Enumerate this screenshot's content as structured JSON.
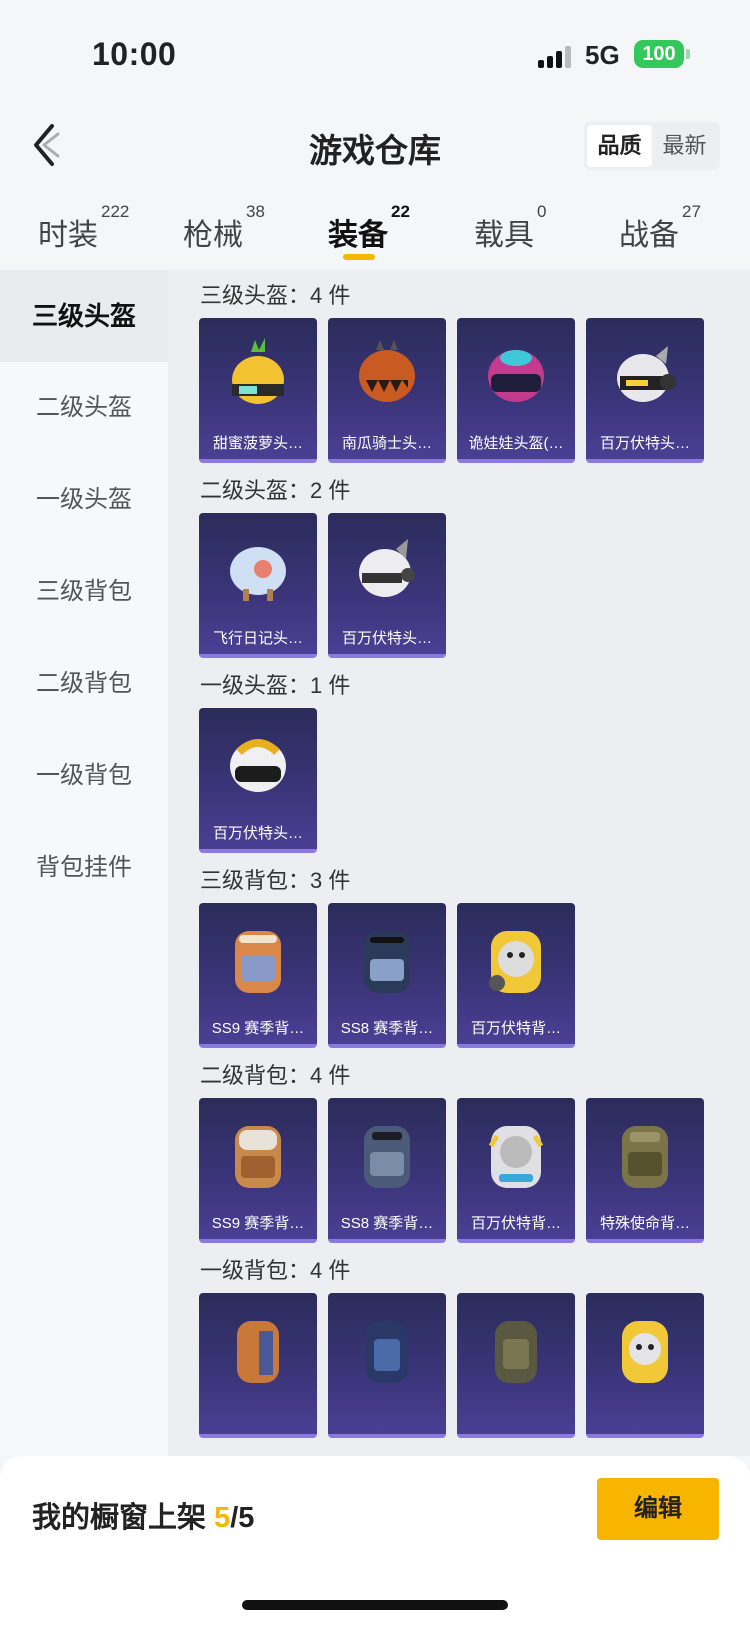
{
  "status": {
    "time": "10:00",
    "network": "5G",
    "battery": "100"
  },
  "header": {
    "title": "游戏仓库",
    "sort_quality": "品质",
    "sort_latest": "最新"
  },
  "tabs": [
    {
      "label": "时装",
      "count": "222"
    },
    {
      "label": "枪械",
      "count": "38"
    },
    {
      "label": "装备",
      "count": "22"
    },
    {
      "label": "载具",
      "count": "0"
    },
    {
      "label": "战备",
      "count": "27"
    }
  ],
  "sidebar": {
    "items": [
      "三级头盔",
      "二级头盔",
      "一级头盔",
      "三级背包",
      "二级背包",
      "一级背包",
      "背包挂件"
    ]
  },
  "sections": [
    {
      "title": "三级头盔：4 件",
      "items": [
        "甜蜜菠萝头…",
        "南瓜骑士头…",
        "诡娃娃头盔(…",
        "百万伏特头…"
      ]
    },
    {
      "title": "二级头盔：2 件",
      "items": [
        "飞行日记头…",
        "百万伏特头…"
      ]
    },
    {
      "title": "一级头盔：1 件",
      "items": [
        "百万伏特头…"
      ]
    },
    {
      "title": "三级背包：3 件",
      "items": [
        "SS9 赛季背…",
        "SS8 赛季背…",
        "百万伏特背…"
      ]
    },
    {
      "title": "二级背包：4 件",
      "items": [
        "SS9 赛季背…",
        "SS8 赛季背…",
        "百万伏特背…",
        "特殊使命背…"
      ]
    },
    {
      "title": "一级背包：4 件",
      "items": [
        "",
        "",
        "",
        ""
      ]
    }
  ],
  "bottom": {
    "label": "我的橱窗上架",
    "count_current": "5",
    "count_total": "/5",
    "edit": "编辑"
  },
  "colors": {
    "accent": "#f5b800",
    "card_bg": "#3a3478",
    "battery": "#34c759"
  }
}
